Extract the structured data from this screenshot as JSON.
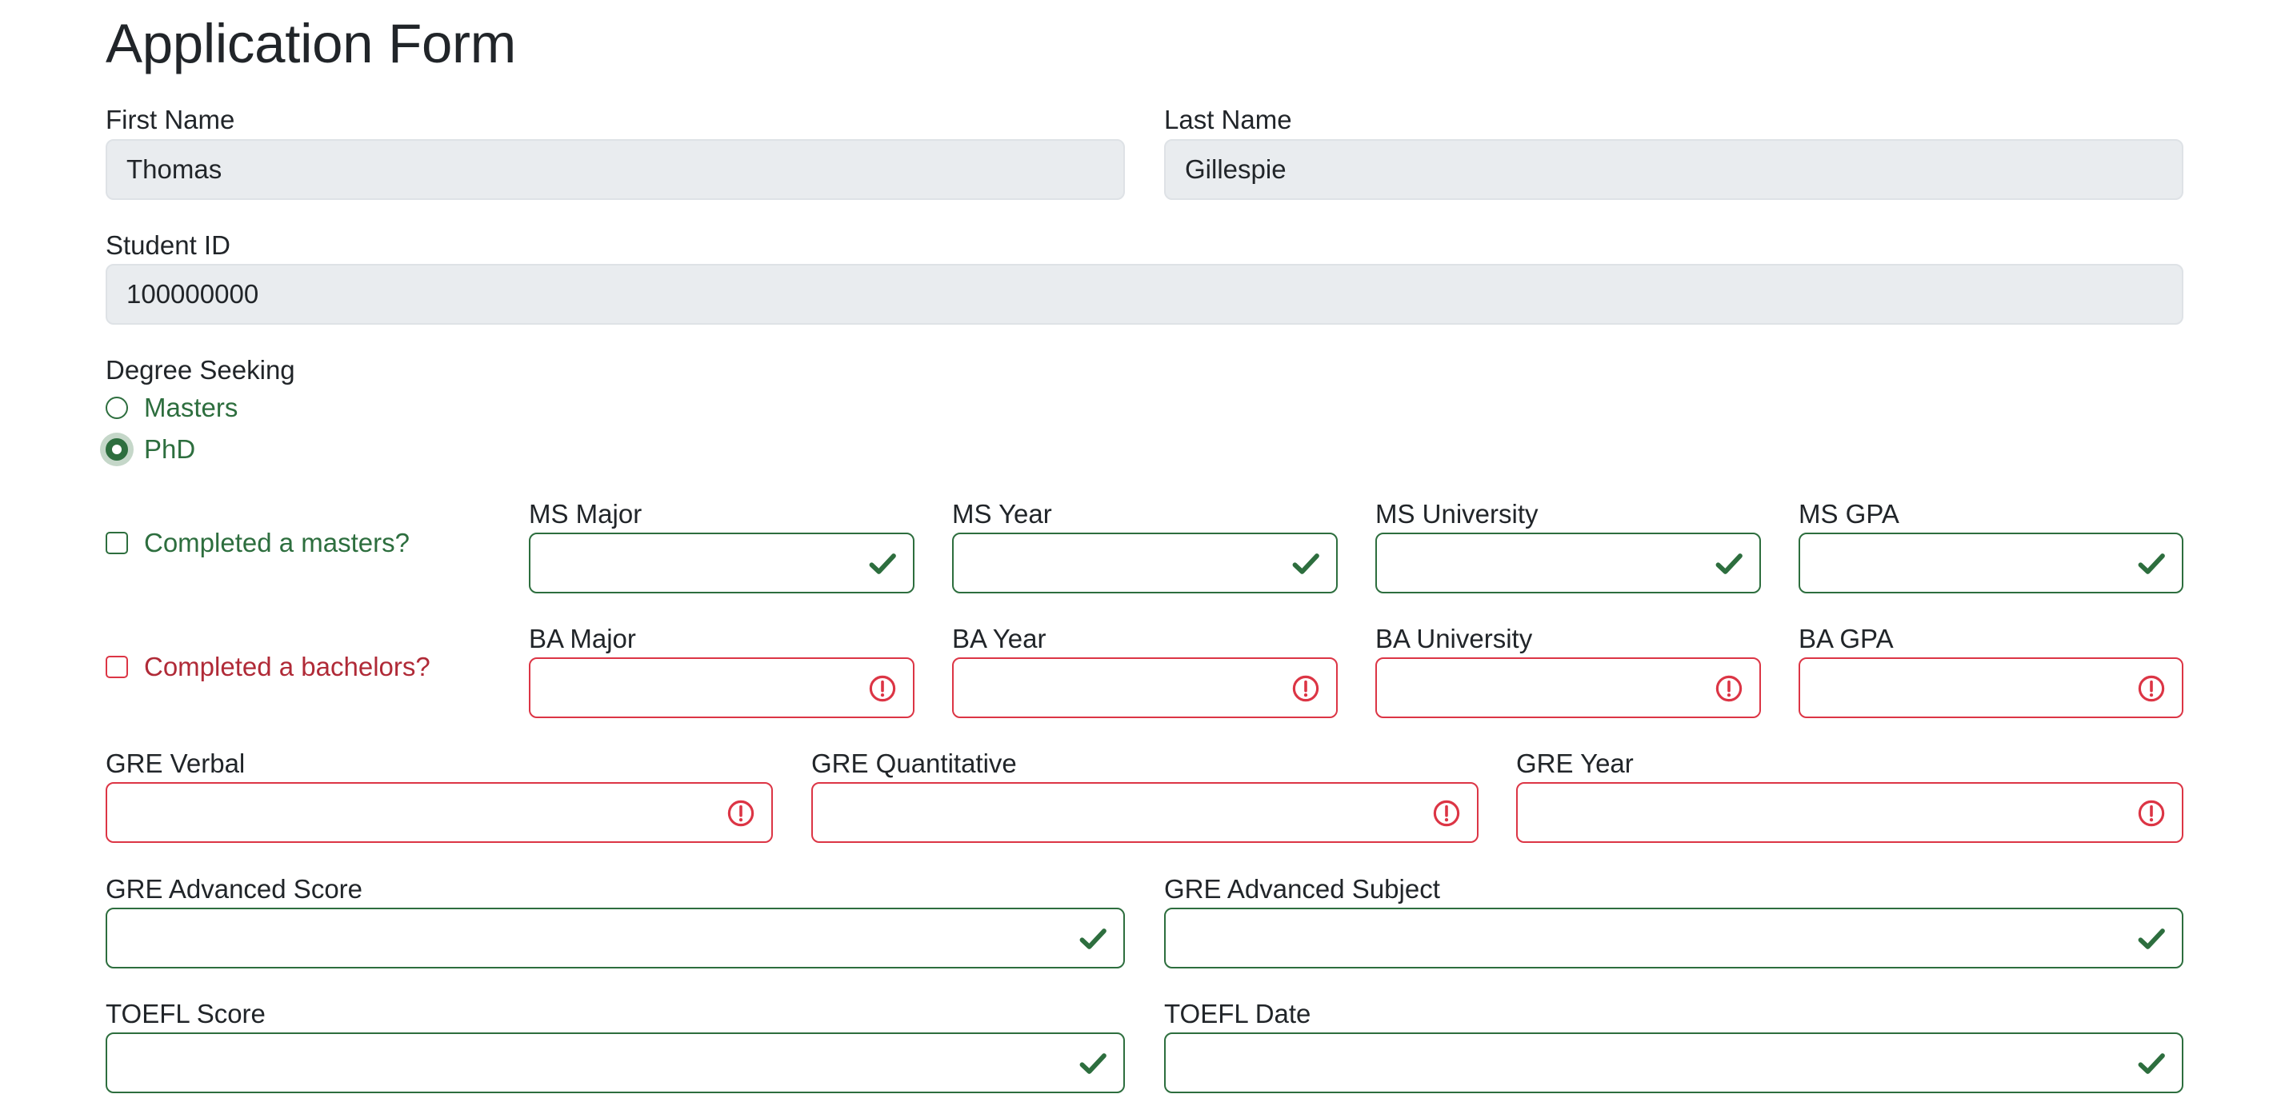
{
  "title": "Application Form",
  "first_name": {
    "label": "First Name",
    "value": "Thomas"
  },
  "last_name": {
    "label": "Last Name",
    "value": "Gillespie"
  },
  "student_id": {
    "label": "Student ID",
    "value": "100000000"
  },
  "degree": {
    "label": "Degree Seeking",
    "options": [
      {
        "label": "Masters",
        "selected": false
      },
      {
        "label": "PhD",
        "selected": true
      }
    ]
  },
  "masters": {
    "checkbox_label": "Completed a masters?",
    "checked": false,
    "status": "valid",
    "fields": [
      {
        "label": "MS Major",
        "value": ""
      },
      {
        "label": "MS Year",
        "value": ""
      },
      {
        "label": "MS University",
        "value": ""
      },
      {
        "label": "MS GPA",
        "value": ""
      }
    ]
  },
  "bachelors": {
    "checkbox_label": "Completed a bachelors?",
    "checked": false,
    "status": "invalid",
    "fields": [
      {
        "label": "BA Major",
        "value": ""
      },
      {
        "label": "BA Year",
        "value": ""
      },
      {
        "label": "BA University",
        "value": ""
      },
      {
        "label": "BA GPA",
        "value": ""
      }
    ]
  },
  "gre": {
    "status": "invalid",
    "fields": [
      {
        "label": "GRE Verbal",
        "value": ""
      },
      {
        "label": "GRE Quantitative",
        "value": ""
      },
      {
        "label": "GRE Year",
        "value": ""
      }
    ]
  },
  "gre_advanced": {
    "status": "valid",
    "fields": [
      {
        "label": "GRE Advanced Score",
        "value": ""
      },
      {
        "label": "GRE Advanced Subject",
        "value": ""
      }
    ]
  },
  "toefl": {
    "status": "valid",
    "fields": [
      {
        "label": "TOEFL Score",
        "value": ""
      },
      {
        "label": "TOEFL Date",
        "value": ""
      }
    ]
  },
  "colors": {
    "valid": "#2d6e3e",
    "invalid": "#dc3545",
    "readonly_bg": "#e9ecef"
  },
  "icons": {
    "valid": "check-icon",
    "invalid": "exclamation-circle-icon"
  }
}
